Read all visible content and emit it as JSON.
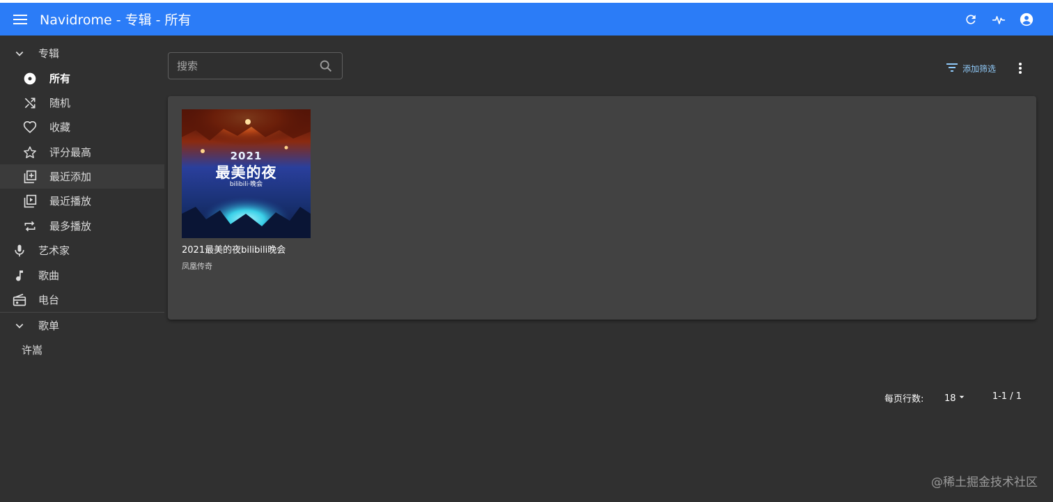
{
  "app": {
    "title": "Navidrome - 专辑 - 所有",
    "accent": "#2b7cf7"
  },
  "header": {
    "actions": [
      {
        "name": "refresh-icon"
      },
      {
        "name": "activity-icon"
      },
      {
        "name": "account-icon"
      }
    ]
  },
  "sidebar": {
    "albums_group": "专辑",
    "albums_items": [
      {
        "label": "所有",
        "icon": "album-disc-icon"
      },
      {
        "label": "随机",
        "icon": "shuffle-icon"
      },
      {
        "label": "收藏",
        "icon": "heart-icon"
      },
      {
        "label": "评分最高",
        "icon": "star-icon"
      },
      {
        "label": "最近添加",
        "icon": "library-add-icon"
      },
      {
        "label": "最近播放",
        "icon": "video-library-icon"
      },
      {
        "label": "最多播放",
        "icon": "repeat-icon"
      }
    ],
    "main_items": [
      {
        "label": "艺术家",
        "icon": "mic-icon"
      },
      {
        "label": "歌曲",
        "icon": "music-note-icon"
      },
      {
        "label": "电台",
        "icon": "radio-icon"
      }
    ],
    "playlists_group": "歌单",
    "playlists": [
      "许嵩"
    ]
  },
  "toolbar": {
    "search_placeholder": "搜索",
    "add_filter": "添加筛选"
  },
  "albums": [
    {
      "title": "2021最美的夜bilibili晚会",
      "artist": "凤凰传奇",
      "cover_year": "2021",
      "cover_main": "最美的夜",
      "cover_sub": "bilibili·晚会"
    }
  ],
  "pagination": {
    "rows_label": "每页行数:",
    "rows_value": "18",
    "range": "1-1 / 1"
  },
  "watermark": "@稀土掘金技术社区"
}
